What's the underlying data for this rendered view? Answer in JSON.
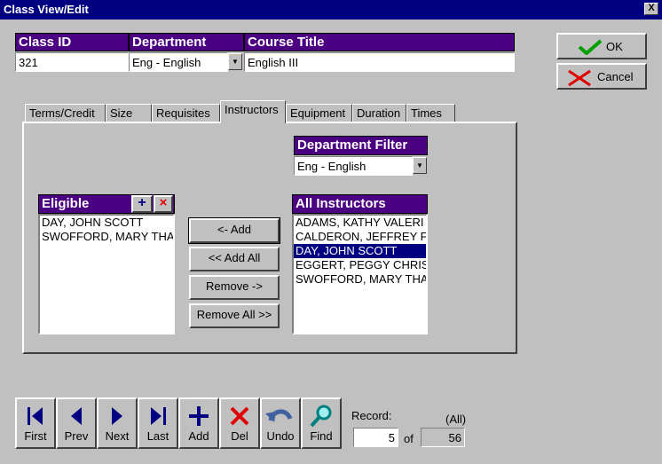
{
  "window": {
    "title": "Class View/Edit",
    "close": "X"
  },
  "header": {
    "class_id_label": "Class ID",
    "class_id_value": "321",
    "department_label": "Department",
    "department_value": "Eng - English",
    "course_title_label": "Course Title",
    "course_title_value": "English III"
  },
  "actions": {
    "ok": "OK",
    "cancel": "Cancel"
  },
  "tabs": [
    "Terms/Credit",
    "Size",
    "Requisites",
    "Instructors",
    "Equipment",
    "Duration",
    "Times"
  ],
  "active_tab": "Instructors",
  "filter": {
    "label": "Department Filter",
    "value": "Eng - English"
  },
  "eligible": {
    "label": "Eligible",
    "add_icon": "+",
    "remove_icon": "×",
    "items": [
      "DAY, JOHN SCOTT",
      "SWOFFORD, MARY THA"
    ]
  },
  "all_instructors": {
    "label": "All Instructors",
    "items": [
      "ADAMS, KATHY VALERI",
      "CALDERON, JEFFREY F",
      "DAY, JOHN SCOTT",
      "EGGERT, PEGGY CHRIS",
      "SWOFFORD, MARY THA"
    ],
    "selected": 2
  },
  "transfer": {
    "add": "<- Add",
    "add_all": "<< Add All",
    "remove": "Remove ->",
    "remove_all": "Remove All >>"
  },
  "nav": {
    "buttons": [
      "First",
      "Prev",
      "Next",
      "Last",
      "Add",
      "Del",
      "Undo",
      "Find"
    ],
    "record_label": "Record:",
    "record_value": "5",
    "of_label": "of",
    "filter_label": "(All)",
    "total": "56"
  },
  "colors": {
    "header_bg": "#4b0082",
    "title_bg": "#000080",
    "selection": "#000080"
  }
}
